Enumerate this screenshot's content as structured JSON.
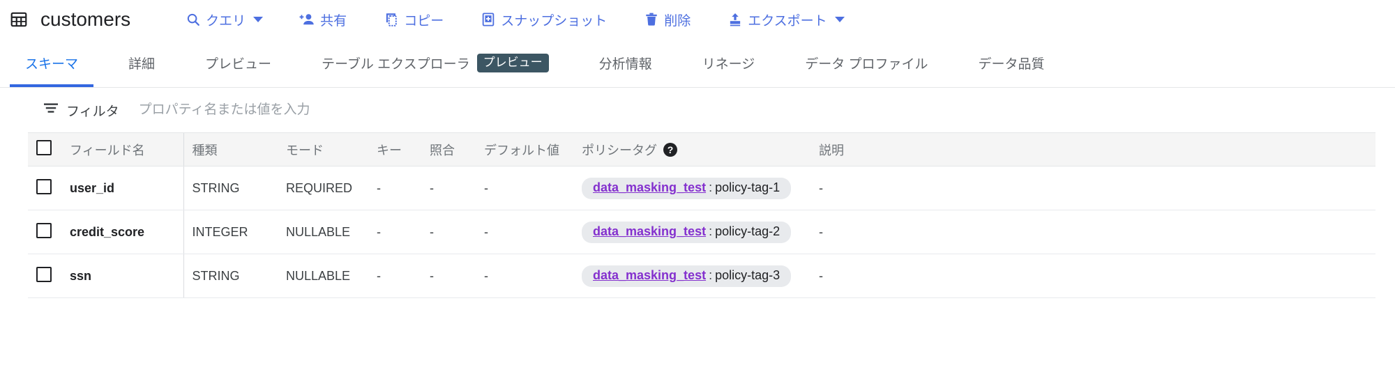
{
  "header": {
    "table_icon": "table-grid-icon",
    "title": "customers",
    "actions": [
      {
        "label": "クエリ",
        "icon": "search-icon",
        "has_caret": true
      },
      {
        "label": "共有",
        "icon": "person-add-icon",
        "has_caret": false
      },
      {
        "label": "コピー",
        "icon": "copy-icon",
        "has_caret": false
      },
      {
        "label": "スナップショット",
        "icon": "snapshot-icon",
        "has_caret": false
      },
      {
        "label": "削除",
        "icon": "trash-icon",
        "has_caret": false
      },
      {
        "label": "エクスポート",
        "icon": "export-upload-icon",
        "has_caret": true
      }
    ]
  },
  "tabs": [
    {
      "label": "スキーマ",
      "active": true,
      "badge": ""
    },
    {
      "label": "詳細",
      "active": false,
      "badge": ""
    },
    {
      "label": "プレビュー",
      "active": false,
      "badge": ""
    },
    {
      "label": "テーブル エクスプローラ",
      "active": false,
      "badge": "プレビュー"
    },
    {
      "label": "分析情報",
      "active": false,
      "badge": ""
    },
    {
      "label": "リネージ",
      "active": false,
      "badge": ""
    },
    {
      "label": "データ プロファイル",
      "active": false,
      "badge": ""
    },
    {
      "label": "データ品質",
      "active": false,
      "badge": ""
    }
  ],
  "filter": {
    "icon": "filter-list-icon",
    "label": "フィルタ",
    "placeholder": "プロパティ名または値を入力",
    "value": ""
  },
  "table": {
    "columns": [
      "フィールド名",
      "種類",
      "モード",
      "キー",
      "照合",
      "デフォルト値",
      "ポリシータグ",
      "説明"
    ],
    "policy_help_icon": "help-icon",
    "rows": [
      {
        "field": "user_id",
        "type": "STRING",
        "mode": "REQUIRED",
        "key": "-",
        "collation": "-",
        "default": "-",
        "policy_taxonomy": "data_masking_test",
        "policy_separator": ":",
        "policy_tag": "policy-tag-1",
        "description": "-"
      },
      {
        "field": "credit_score",
        "type": "INTEGER",
        "mode": "NULLABLE",
        "key": "-",
        "collation": "-",
        "default": "-",
        "policy_taxonomy": "data_masking_test",
        "policy_separator": ":",
        "policy_tag": "policy-tag-2",
        "description": "-"
      },
      {
        "field": "ssn",
        "type": "STRING",
        "mode": "NULLABLE",
        "key": "-",
        "collation": "-",
        "default": "-",
        "policy_taxonomy": "data_masking_test",
        "policy_separator": ":",
        "policy_tag": "policy-tag-3",
        "description": "-"
      }
    ]
  },
  "colors": {
    "accent_blue": "#4d6fe0",
    "active_tab": "#1a73e8",
    "badge_bg": "#3c5663",
    "policy_purple": "#8430ce",
    "chip_bg": "#e8eaed"
  }
}
